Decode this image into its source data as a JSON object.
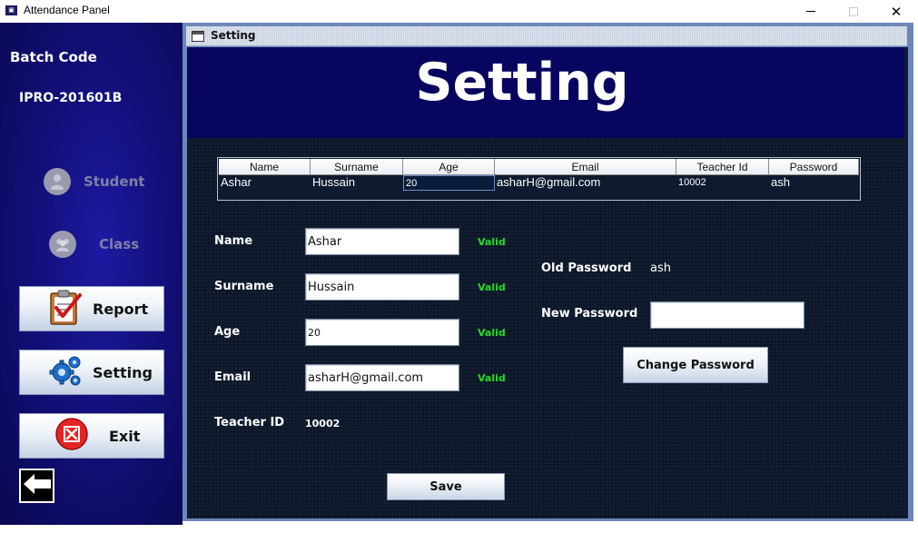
{
  "window": {
    "title": "Attendance Panel",
    "minimize_glyph": "",
    "maximize_glyph": "",
    "close_glyph": "✕"
  },
  "sidebar": {
    "batch_label": "Batch Code",
    "batch_code": "IPRO-201601B",
    "items": [
      {
        "label": "Student",
        "icon": "student-icon",
        "enabled": false
      },
      {
        "label": "Class",
        "icon": "class-icon",
        "enabled": false
      },
      {
        "label": "Report",
        "icon": "clipboard-check-icon",
        "enabled": true
      },
      {
        "label": "Setting",
        "icon": "gears-icon",
        "enabled": true
      },
      {
        "label": "Exit",
        "icon": "exit-x-icon",
        "enabled": true
      }
    ],
    "back_icon": "arrow-left-icon"
  },
  "frame": {
    "title": "Setting",
    "heading": "Setting"
  },
  "table": {
    "columns": [
      "Name",
      "Surname",
      "Age",
      "Email",
      "Teacher Id",
      "Password"
    ],
    "rows": [
      [
        "Ashar",
        "Hussain",
        "20",
        "asharH@gmail.com",
        "10002",
        "ash"
      ]
    ]
  },
  "form": {
    "name_label": "Name",
    "name_value": "Ashar",
    "name_status": "Valid",
    "surname_label": "Surname",
    "surname_value": "Hussain",
    "surname_status": "Valid",
    "age_label": "Age",
    "age_value": "20",
    "age_status": "Valid",
    "email_label": "Email",
    "email_value": "asharH@gmail.com",
    "email_status": "Valid",
    "teacher_id_label": "Teacher ID",
    "teacher_id_value": "10002",
    "save_label": "Save"
  },
  "password": {
    "old_label": "Old Password",
    "old_value": "ash",
    "new_label": "New Password",
    "new_value": "",
    "change_label": "Change Password"
  },
  "colors": {
    "sidebar_bg": "#12107a",
    "header_bg": "#07055f",
    "valid": "#22dd22",
    "frame_border": "#6e87b8"
  }
}
